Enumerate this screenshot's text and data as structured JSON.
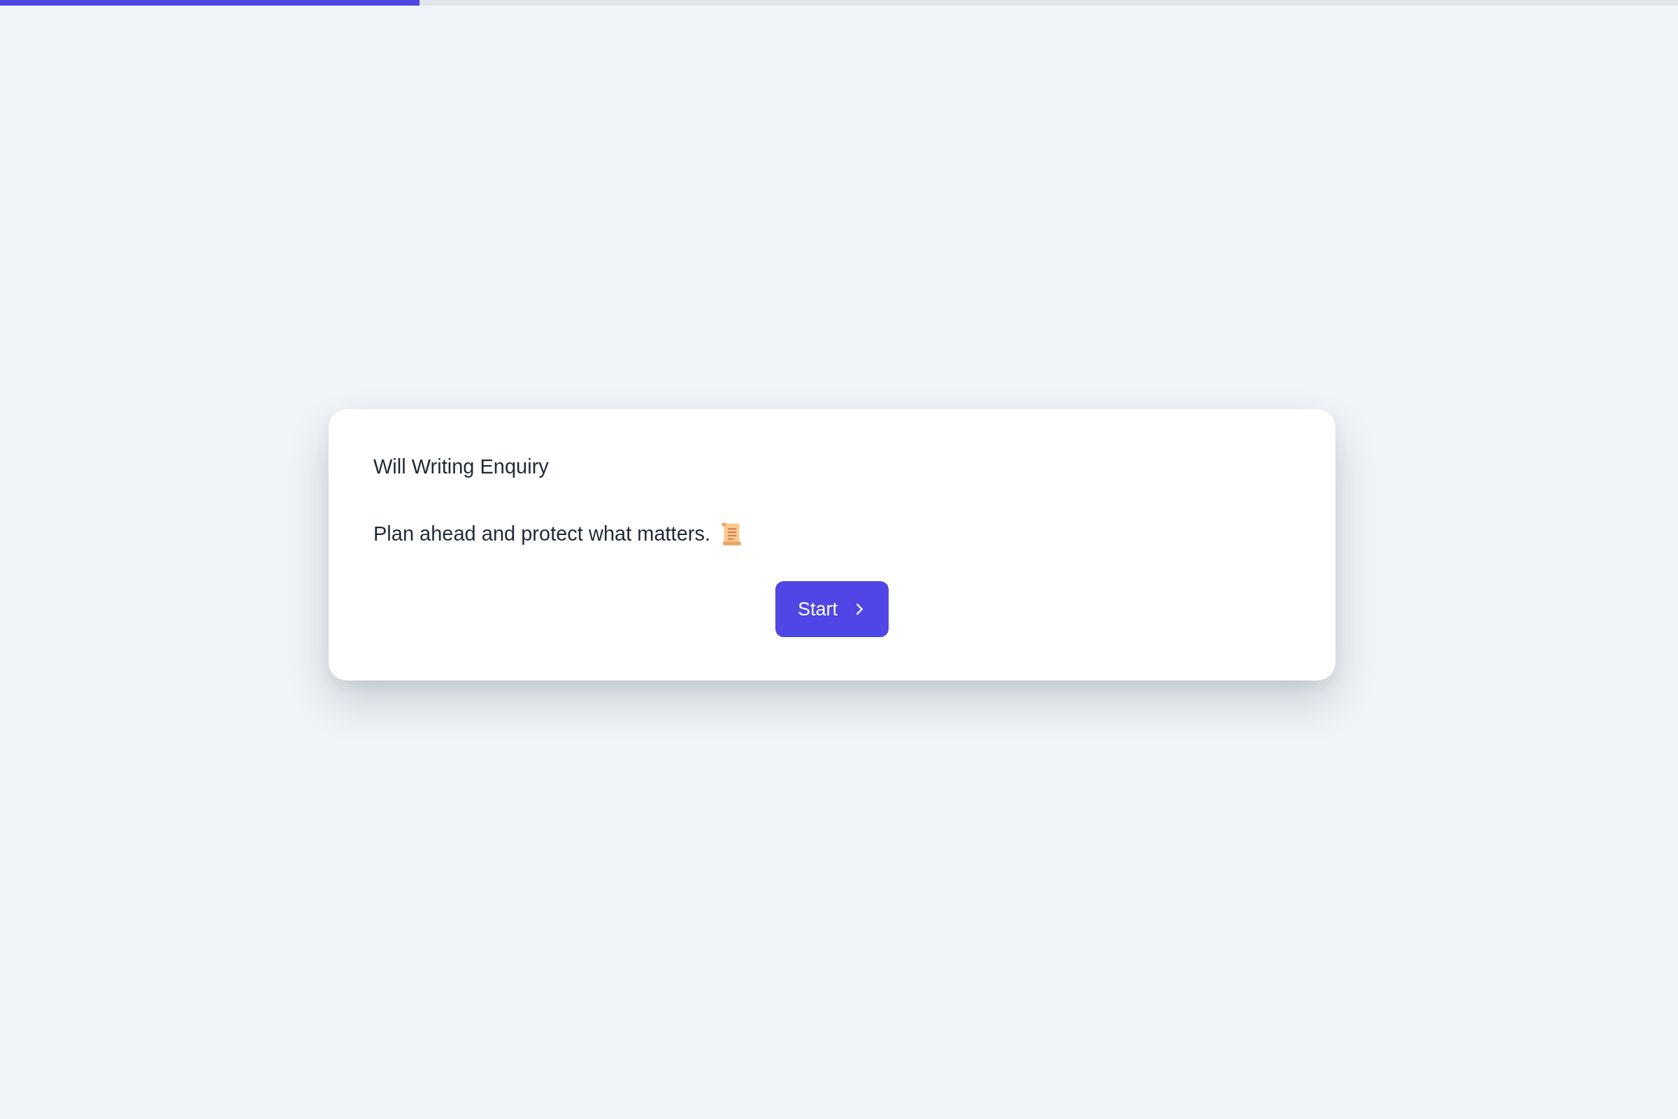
{
  "progress": {
    "level": 0.25
  },
  "card": {
    "title": "Will Writing Enquiry",
    "description": "Plan ahead and protect what matters."
  },
  "start_button": {
    "label": "Start"
  }
}
